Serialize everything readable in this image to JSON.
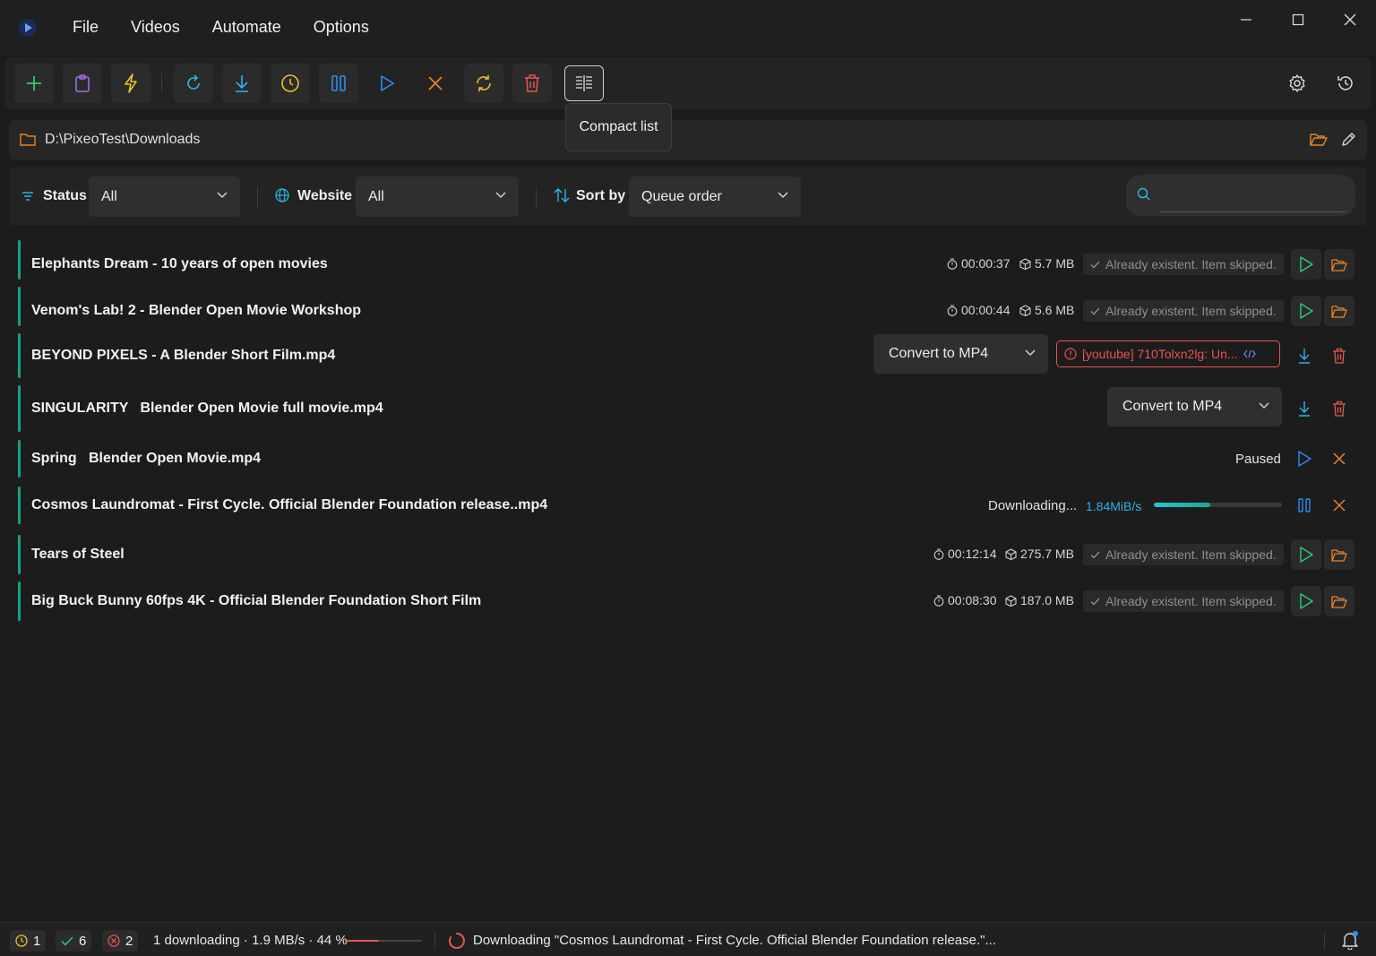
{
  "menu": {
    "items": [
      "File",
      "Videos",
      "Automate",
      "Options"
    ]
  },
  "toolbar": {
    "tooltip": "Compact list"
  },
  "path": {
    "value": "D:\\PixeoTest\\Downloads"
  },
  "filters": {
    "status_label": "Status",
    "status_value": "All",
    "website_label": "Website",
    "website_value": "All",
    "sort_label": "Sort by",
    "sort_value": "Queue order",
    "search_placeholder": ""
  },
  "items": [
    {
      "title": "Elephants Dream - 10 years of open movies",
      "duration": "00:00:37",
      "size": "5.7 MB",
      "status": "Already existent. Item skipped."
    },
    {
      "title": "Venom's Lab! 2 - Blender Open Movie Workshop",
      "duration": "00:00:44",
      "size": "5.6 MB",
      "status": "Already existent. Item skipped."
    },
    {
      "title": "BEYOND PIXELS - A Blender Short Film.mp4",
      "convert": "Convert to MP4",
      "error": "[youtube] 710Tolxn2lg: Un..."
    },
    {
      "title": "SINGULARITY   Blender Open Movie full movie.mp4",
      "convert": "Convert to MP4"
    },
    {
      "title": "Spring   Blender Open Movie.mp4",
      "status": "Paused"
    },
    {
      "title": "Cosmos Laundromat - First Cycle. Official Blender Foundation release..mp4",
      "status": "Downloading...",
      "speed": "1.84MiB/s",
      "progress": 0.44
    },
    {
      "title": "Tears of Steel",
      "duration": "00:12:14",
      "size": "275.7 MB",
      "status": "Already existent. Item skipped."
    },
    {
      "title": "Big Buck Bunny 60fps 4K - Official Blender Foundation Short Film",
      "duration": "00:08:30",
      "size": "187.0 MB",
      "status": "Already existent. Item skipped."
    }
  ],
  "statusbar": {
    "pending_count": "1",
    "done_count": "6",
    "error_count": "2",
    "summary": "1 downloading · 1.9 MB/s · 44 %",
    "summary_progress": 0.44,
    "activity": "Downloading \"Cosmos Laundromat - First Cycle. Official Blender Foundation release.\"..."
  },
  "colors": {
    "accent_green": "#16a085",
    "accent_blue": "#2eb3e6",
    "error_red": "#e4574e",
    "warn_yellow": "#e6c229",
    "orange": "#e8832a"
  }
}
